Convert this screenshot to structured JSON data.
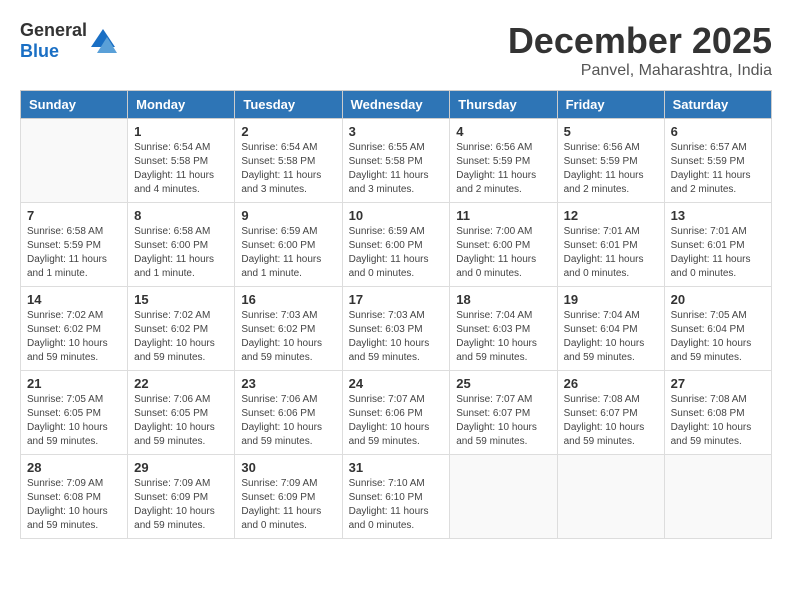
{
  "logo": {
    "general": "General",
    "blue": "Blue"
  },
  "title": "December 2025",
  "location": "Panvel, Maharashtra, India",
  "days_of_week": [
    "Sunday",
    "Monday",
    "Tuesday",
    "Wednesday",
    "Thursday",
    "Friday",
    "Saturday"
  ],
  "weeks": [
    [
      {
        "day": "",
        "info": ""
      },
      {
        "day": "1",
        "info": "Sunrise: 6:54 AM\nSunset: 5:58 PM\nDaylight: 11 hours\nand 4 minutes."
      },
      {
        "day": "2",
        "info": "Sunrise: 6:54 AM\nSunset: 5:58 PM\nDaylight: 11 hours\nand 3 minutes."
      },
      {
        "day": "3",
        "info": "Sunrise: 6:55 AM\nSunset: 5:58 PM\nDaylight: 11 hours\nand 3 minutes."
      },
      {
        "day": "4",
        "info": "Sunrise: 6:56 AM\nSunset: 5:59 PM\nDaylight: 11 hours\nand 2 minutes."
      },
      {
        "day": "5",
        "info": "Sunrise: 6:56 AM\nSunset: 5:59 PM\nDaylight: 11 hours\nand 2 minutes."
      },
      {
        "day": "6",
        "info": "Sunrise: 6:57 AM\nSunset: 5:59 PM\nDaylight: 11 hours\nand 2 minutes."
      }
    ],
    [
      {
        "day": "7",
        "info": "Sunrise: 6:58 AM\nSunset: 5:59 PM\nDaylight: 11 hours\nand 1 minute."
      },
      {
        "day": "8",
        "info": "Sunrise: 6:58 AM\nSunset: 6:00 PM\nDaylight: 11 hours\nand 1 minute."
      },
      {
        "day": "9",
        "info": "Sunrise: 6:59 AM\nSunset: 6:00 PM\nDaylight: 11 hours\nand 1 minute."
      },
      {
        "day": "10",
        "info": "Sunrise: 6:59 AM\nSunset: 6:00 PM\nDaylight: 11 hours\nand 0 minutes."
      },
      {
        "day": "11",
        "info": "Sunrise: 7:00 AM\nSunset: 6:00 PM\nDaylight: 11 hours\nand 0 minutes."
      },
      {
        "day": "12",
        "info": "Sunrise: 7:01 AM\nSunset: 6:01 PM\nDaylight: 11 hours\nand 0 minutes."
      },
      {
        "day": "13",
        "info": "Sunrise: 7:01 AM\nSunset: 6:01 PM\nDaylight: 11 hours\nand 0 minutes."
      }
    ],
    [
      {
        "day": "14",
        "info": "Sunrise: 7:02 AM\nSunset: 6:02 PM\nDaylight: 10 hours\nand 59 minutes."
      },
      {
        "day": "15",
        "info": "Sunrise: 7:02 AM\nSunset: 6:02 PM\nDaylight: 10 hours\nand 59 minutes."
      },
      {
        "day": "16",
        "info": "Sunrise: 7:03 AM\nSunset: 6:02 PM\nDaylight: 10 hours\nand 59 minutes."
      },
      {
        "day": "17",
        "info": "Sunrise: 7:03 AM\nSunset: 6:03 PM\nDaylight: 10 hours\nand 59 minutes."
      },
      {
        "day": "18",
        "info": "Sunrise: 7:04 AM\nSunset: 6:03 PM\nDaylight: 10 hours\nand 59 minutes."
      },
      {
        "day": "19",
        "info": "Sunrise: 7:04 AM\nSunset: 6:04 PM\nDaylight: 10 hours\nand 59 minutes."
      },
      {
        "day": "20",
        "info": "Sunrise: 7:05 AM\nSunset: 6:04 PM\nDaylight: 10 hours\nand 59 minutes."
      }
    ],
    [
      {
        "day": "21",
        "info": "Sunrise: 7:05 AM\nSunset: 6:05 PM\nDaylight: 10 hours\nand 59 minutes."
      },
      {
        "day": "22",
        "info": "Sunrise: 7:06 AM\nSunset: 6:05 PM\nDaylight: 10 hours\nand 59 minutes."
      },
      {
        "day": "23",
        "info": "Sunrise: 7:06 AM\nSunset: 6:06 PM\nDaylight: 10 hours\nand 59 minutes."
      },
      {
        "day": "24",
        "info": "Sunrise: 7:07 AM\nSunset: 6:06 PM\nDaylight: 10 hours\nand 59 minutes."
      },
      {
        "day": "25",
        "info": "Sunrise: 7:07 AM\nSunset: 6:07 PM\nDaylight: 10 hours\nand 59 minutes."
      },
      {
        "day": "26",
        "info": "Sunrise: 7:08 AM\nSunset: 6:07 PM\nDaylight: 10 hours\nand 59 minutes."
      },
      {
        "day": "27",
        "info": "Sunrise: 7:08 AM\nSunset: 6:08 PM\nDaylight: 10 hours\nand 59 minutes."
      }
    ],
    [
      {
        "day": "28",
        "info": "Sunrise: 7:09 AM\nSunset: 6:08 PM\nDaylight: 10 hours\nand 59 minutes."
      },
      {
        "day": "29",
        "info": "Sunrise: 7:09 AM\nSunset: 6:09 PM\nDaylight: 10 hours\nand 59 minutes."
      },
      {
        "day": "30",
        "info": "Sunrise: 7:09 AM\nSunset: 6:09 PM\nDaylight: 11 hours\nand 0 minutes."
      },
      {
        "day": "31",
        "info": "Sunrise: 7:10 AM\nSunset: 6:10 PM\nDaylight: 11 hours\nand 0 minutes."
      },
      {
        "day": "",
        "info": ""
      },
      {
        "day": "",
        "info": ""
      },
      {
        "day": "",
        "info": ""
      }
    ]
  ]
}
